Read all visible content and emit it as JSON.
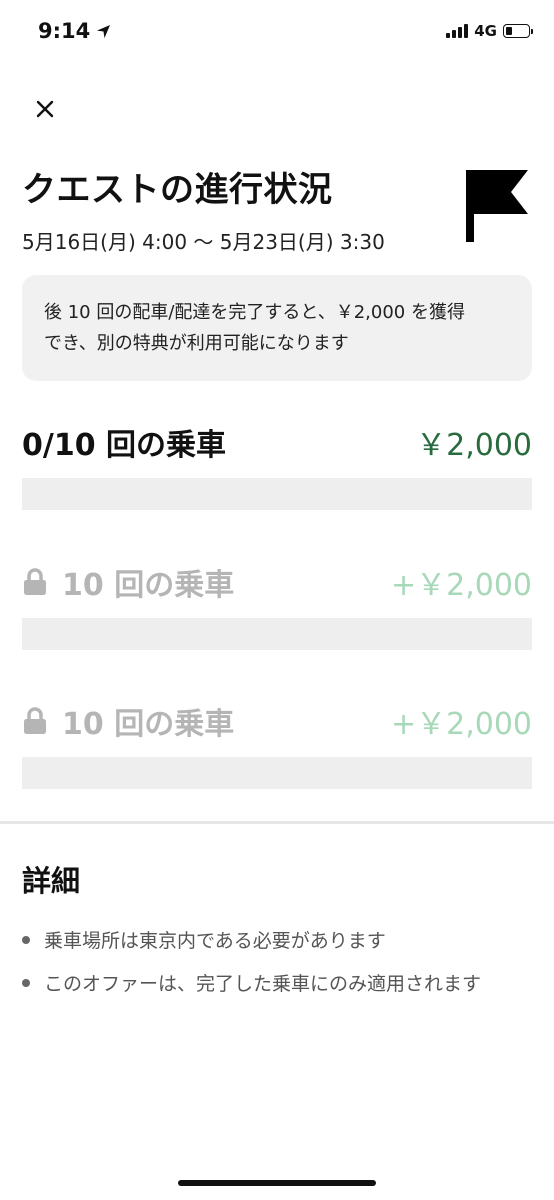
{
  "status_bar": {
    "time": "9:14",
    "network": "4G",
    "battery_level": 0.3
  },
  "header": {
    "title": "クエストの進行状況",
    "date_range": "5月16日(月) 4:00 〜 5月23日(月) 3:30"
  },
  "info": {
    "text_line1": "後 10 回の配車/配達を完了すると、￥2,000 を獲得",
    "text_line2": "でき、別の特典が利用可能になります"
  },
  "quests": [
    {
      "label": "0/10 回の乗車",
      "amount": "￥2,000",
      "locked": false,
      "progress": 0
    },
    {
      "label": "10 回の乗車",
      "amount": "+￥2,000",
      "locked": true,
      "progress": 0
    },
    {
      "label": "10 回の乗車",
      "amount": "+￥2,000",
      "locked": true,
      "progress": 0
    }
  ],
  "details": {
    "title": "詳細",
    "items": [
      "乗車場所は東京内である必要があります",
      "このオファーは、完了した乗車にのみ適用されます"
    ]
  },
  "colors": {
    "accent_green": "#276b3e",
    "locked_green": "#a7d8b7",
    "locked_gray": "#b5b5b5",
    "bar_bg": "#eeeeee"
  },
  "icons": [
    "location-arrow-icon",
    "signal-icon",
    "battery-icon",
    "close-icon",
    "flag-icon",
    "lock-icon"
  ]
}
